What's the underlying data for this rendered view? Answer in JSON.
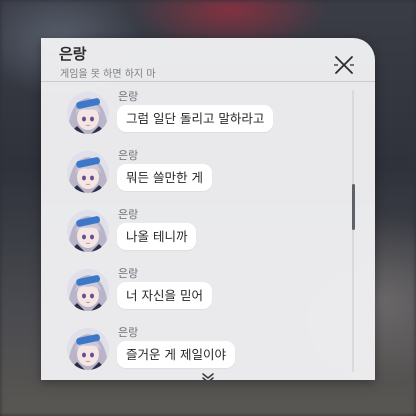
{
  "dialog": {
    "title": "은랑",
    "subtitle": "게임을 못 하면 하지 마"
  },
  "icons": {
    "close": "close-icon",
    "more": "chevron-down-icon",
    "avatar": "character-portrait"
  },
  "messages": [
    {
      "sender": "은랑",
      "text": "그럼 일단 돌리고 말하라고"
    },
    {
      "sender": "은랑",
      "text": "뭐든 쓸만한 게"
    },
    {
      "sender": "은랑",
      "text": "나올 테니까"
    },
    {
      "sender": "은랑",
      "text": "너 자신을 믿어"
    },
    {
      "sender": "은랑",
      "text": "즐거운 게 제일이야"
    }
  ],
  "colors": {
    "panel": "#EFF0F2",
    "bubble": "#FFFFFF",
    "text": "#26272B",
    "hair": "#C9C6D4",
    "visor": "#3D78C8"
  }
}
